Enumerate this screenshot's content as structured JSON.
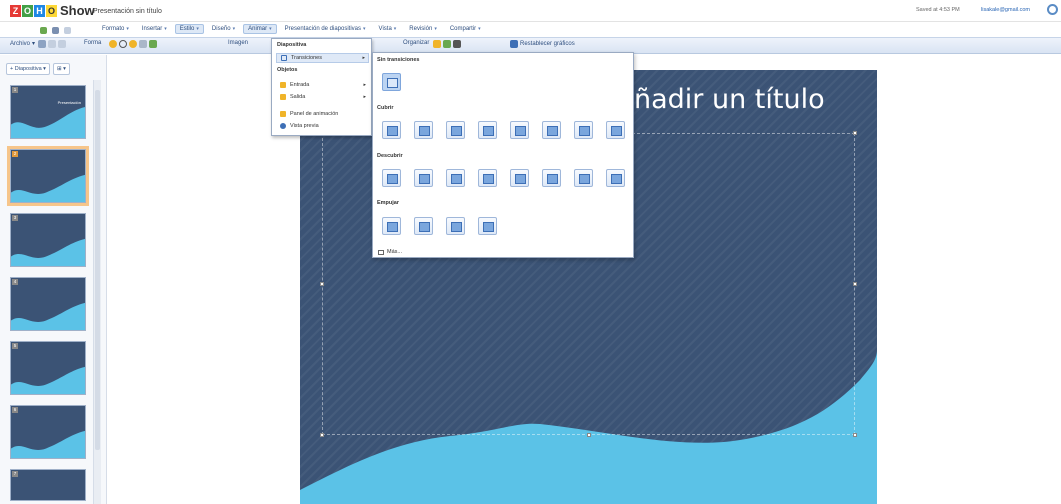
{
  "app": {
    "logo_letters": [
      "Z",
      "O",
      "H",
      "O"
    ],
    "logo_colors": [
      "#e53935",
      "#43a047",
      "#1e88e5",
      "#fdd835"
    ],
    "name": "Show",
    "doc_title": "Presentación sin título",
    "saved_status": "Saved at 4:53 PM",
    "user": "lisakale@gmail.com"
  },
  "menubar": [
    {
      "label": "Formato"
    },
    {
      "label": "Insertar"
    },
    {
      "label": "Estilo"
    },
    {
      "label": "Diseño"
    },
    {
      "label": "Animar"
    },
    {
      "label": "Presentación de diapositivas"
    },
    {
      "label": "Vista"
    },
    {
      "label": "Revisión"
    },
    {
      "label": "Compartir"
    }
  ],
  "toolbar": {
    "file": "Archivo",
    "shape": "Forma",
    "image": "Imagen",
    "arrange": "Organizar",
    "reset_graphics": "Restablecer gráficos"
  },
  "left_panel": {
    "slide_button": "Diapositiva",
    "thumb_title": "Presentación",
    "slides": [
      {
        "num": "1"
      },
      {
        "num": "2"
      },
      {
        "num": "3"
      },
      {
        "num": "4"
      },
      {
        "num": "5"
      },
      {
        "num": "6"
      },
      {
        "num": "7"
      }
    ]
  },
  "slide": {
    "title": "ñadir un título"
  },
  "animate_menu": {
    "section_slide": "Diapositiva",
    "transitions": "Transiciones",
    "section_objects": "Objetos",
    "entrance": "Entrada",
    "exit": "Salida",
    "anim_panel": "Panel de animación",
    "preview": "Vista previa"
  },
  "transitions_menu": {
    "none": "Sin transiciones",
    "cover": "Cubrir",
    "uncover": "Descubrir",
    "push": "Empujar",
    "more": "Más..."
  },
  "colors": {
    "slide_bg": "#3b5375",
    "wave": "#5bc2e7",
    "accent": "#2f4f7f"
  }
}
